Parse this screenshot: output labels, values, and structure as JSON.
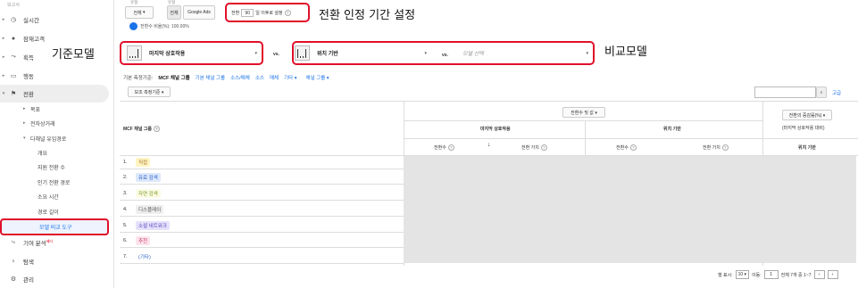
{
  "sidebar": {
    "top_label": "보고서",
    "items": [
      {
        "label": "실시간",
        "icon": "clock-icon",
        "glyph": "◷"
      },
      {
        "label": "잠재고객",
        "icon": "person-icon",
        "glyph": "●"
      },
      {
        "label": "획득",
        "icon": "acquisition-icon",
        "glyph": "⤳"
      },
      {
        "label": "행동",
        "icon": "behavior-icon",
        "glyph": "▭"
      },
      {
        "label": "전환",
        "icon": "flag-icon",
        "glyph": "⚑"
      }
    ],
    "conversion_sub": [
      {
        "label": "목표"
      },
      {
        "label": "전자상거래"
      },
      {
        "label": "다채널 유입경로"
      }
    ],
    "mcf_sub": [
      {
        "label": "개요"
      },
      {
        "label": "지원 전환 수"
      },
      {
        "label": "인기 전환 경로"
      },
      {
        "label": "소요 시간"
      },
      {
        "label": "경로 길이"
      },
      {
        "label": "모델 비교 도구"
      }
    ],
    "bottom": [
      {
        "label": "기여 분석",
        "badge": "베타",
        "icon": "attribution-icon",
        "glyph": "⤷"
      },
      {
        "label": "탐색",
        "icon": "lightbulb-icon",
        "glyph": "♀"
      },
      {
        "label": "관리",
        "icon": "gear-icon",
        "glyph": "⚙"
      }
    ]
  },
  "toolbar": {
    "group1_label": "유형",
    "type_value": "전체",
    "group2_label": "유형",
    "all_btn": "전체",
    "google_ads_btn": "Google Ads",
    "lookback_prefix": "전환",
    "lookback_value": "90",
    "lookback_suffix": "일 이후로 설정",
    "conversion_rate": "전환수 비율(%): 100.00%"
  },
  "annotations": {
    "lookback": "전환 인정 기간 설정",
    "baseline": "기준모델",
    "compare": "비교모델"
  },
  "models": {
    "baseline": "마지막 상호작용",
    "vs1": "vs.",
    "compare1": "위치 기반",
    "vs2": "vs.",
    "compare2_placeholder": "모델 선택"
  },
  "dimension_row": {
    "label": "기본 측정기준:",
    "active": "MCF 채널 그룹",
    "links": [
      "기본 채널 그룹",
      "소스/매체",
      "소스",
      "매체",
      "기타 ▾",
      "채널 그룹 ▾"
    ]
  },
  "secondary_dim": "보조 측정기준 ▾",
  "search": {
    "placeholder": "",
    "advanced": "고급"
  },
  "table": {
    "col_channel": "MCF 채널 그룹",
    "metric_select": "전환수 및 값 ▾",
    "model1_header": "마지막 상호작용",
    "model2_header": "위치 기반",
    "col_conv1": "전환수",
    "col_value1": "전환 가치",
    "col_conv2": "전환수",
    "col_value2": "전환 가치",
    "pct_change_select": "전환의 증감률(%) ▾",
    "pct_change_note": "(마지막 상호작용 대비)",
    "pct_col": "위치 기반",
    "rows": [
      {
        "n": "1.",
        "label": "직접",
        "bg": "#fff4c2",
        "fg": "#a0742a"
      },
      {
        "n": "2.",
        "label": "유료 검색",
        "bg": "#dde8fb",
        "fg": "#2a62c9"
      },
      {
        "n": "3.",
        "label": "자연 검색",
        "bg": "#fbfbe6",
        "fg": "#7a9a20"
      },
      {
        "n": "4.",
        "label": "디스플레이",
        "bg": "#eeeeee",
        "fg": "#555555"
      },
      {
        "n": "5.",
        "label": "소셜 네트워크",
        "bg": "#e6e1fb",
        "fg": "#5b45c0"
      },
      {
        "n": "6.",
        "label": "추천",
        "bg": "#fde4ec",
        "fg": "#c73a6a"
      },
      {
        "n": "7.",
        "label": "(기타)",
        "bg": "#ffffff",
        "fg": "#2a62c9"
      }
    ]
  },
  "pager": {
    "show_rows": "행 표시:",
    "rows_value": "10",
    "goto": "이동:",
    "goto_value": "1",
    "range": "전체 7개 중 1~7"
  }
}
